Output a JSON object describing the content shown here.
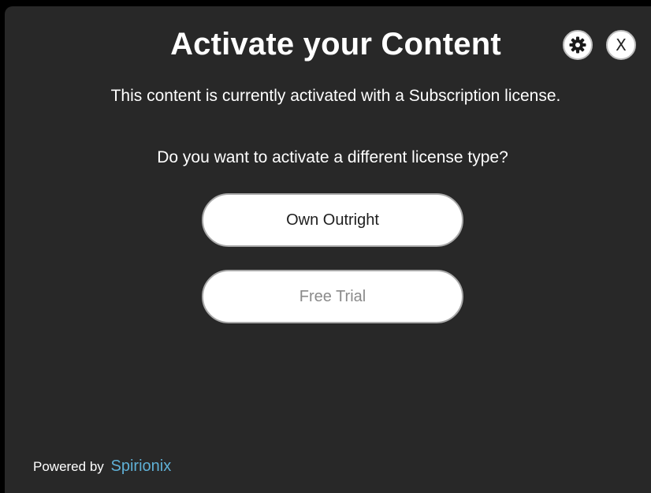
{
  "dialog": {
    "title": "Activate your Content",
    "status_text": "This content is currently activated with a Subscription license.",
    "question_text": "Do you want to activate a different license type?",
    "buttons": {
      "own_outright": "Own Outright",
      "free_trial": "Free Trial",
      "close": "X"
    },
    "icons": {
      "settings": "gear-icon"
    }
  },
  "footer": {
    "powered_by": "Powered by",
    "brand": "Spirionix"
  },
  "colors": {
    "background": "#282828",
    "brand_link": "#5fb0d6",
    "disabled_text": "#8a8a8a"
  }
}
